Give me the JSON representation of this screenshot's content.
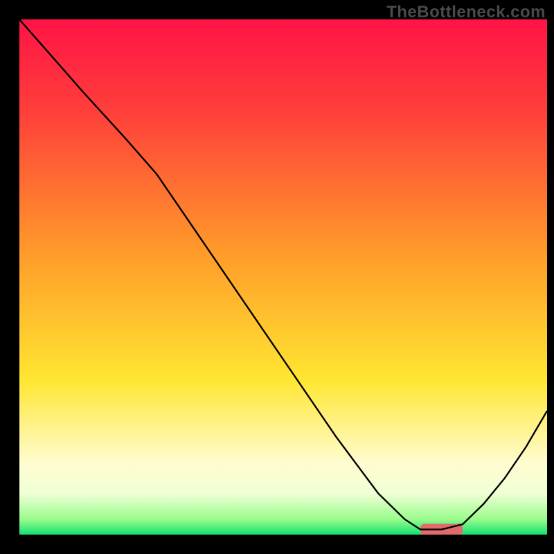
{
  "watermark": "TheBottleneck.com",
  "chart_data": {
    "type": "line",
    "title": "",
    "xlabel": "",
    "ylabel": "",
    "xlim": [
      0,
      100
    ],
    "ylim": [
      0,
      100
    ],
    "grid": false,
    "legend": false,
    "gradient_stops": [
      {
        "offset": 0.0,
        "color": "#ff1446"
      },
      {
        "offset": 0.18,
        "color": "#ff3f3a"
      },
      {
        "offset": 0.45,
        "color": "#ff9a2a"
      },
      {
        "offset": 0.7,
        "color": "#ffe631"
      },
      {
        "offset": 0.86,
        "color": "#fffccf"
      },
      {
        "offset": 0.92,
        "color": "#f0ffd6"
      },
      {
        "offset": 0.97,
        "color": "#9afc8c"
      },
      {
        "offset": 1.0,
        "color": "#14e070"
      }
    ],
    "series": [
      {
        "name": "curve",
        "color": "#000000",
        "x": [
          0,
          6,
          12,
          20,
          26,
          30,
          40,
          50,
          60,
          68,
          73,
          76,
          80,
          84,
          88,
          92,
          96,
          100
        ],
        "y": [
          100,
          93,
          86,
          77,
          70,
          64,
          49,
          34,
          19,
          8,
          3,
          1,
          1,
          2,
          6,
          11,
          17,
          24
        ]
      }
    ],
    "marker": {
      "name": "highlight-pill",
      "color": "#e26a6a",
      "x_start": 76,
      "x_end": 84,
      "y": 1,
      "height": 2.2
    }
  }
}
